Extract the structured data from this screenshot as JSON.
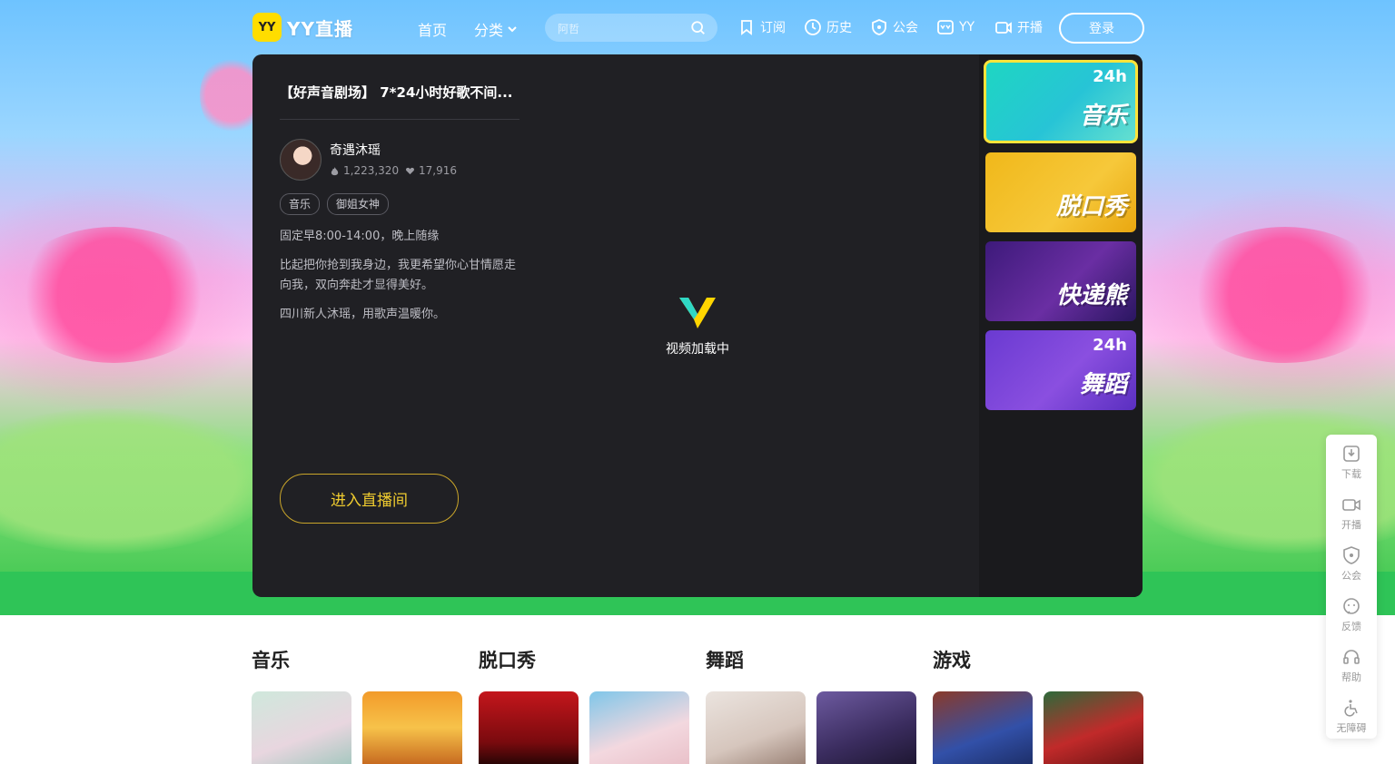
{
  "nav": {
    "logo_mark": "YY",
    "logo_text": "YY直播",
    "home": "首页",
    "category": "分类",
    "search_placeholder": "阿哲",
    "subscribe": "订阅",
    "history": "历史",
    "guild": "公会",
    "yy": "YY",
    "broadcast": "开播",
    "login": "登录"
  },
  "room": {
    "title": "【好声音剧场】 7*24小时好歌不间...",
    "host_name": "奇遇沐瑶",
    "popularity": "1,223,320",
    "likes": "17,916",
    "tags": [
      "音乐",
      "御姐女神"
    ],
    "desc1": "固定早8:00-14:00，晚上随缘",
    "desc2": "比起把你抢到我身边，我更希望你心甘情愿走向我，双向奔赴才显得美好。",
    "desc3": "四川新人沐瑶，用歌声温暖你。",
    "enter_label": "进入直播间",
    "loading_text": "视频加载中"
  },
  "channels": [
    {
      "label": "音乐",
      "badge": "24h",
      "active": true
    },
    {
      "label": "脱口秀",
      "badge": "",
      "active": false
    },
    {
      "label": "快递熊",
      "badge": "",
      "active": false
    },
    {
      "label": "舞蹈",
      "badge": "24h",
      "active": false
    }
  ],
  "float_bar": [
    "下载",
    "开播",
    "公会",
    "反馈",
    "帮助",
    "无障碍"
  ],
  "sections": [
    "音乐",
    "脱口秀",
    "舞蹈",
    "游戏"
  ],
  "colors": {
    "accent_yellow": "#ffdd00",
    "enter_gold": "#f0cc2f",
    "player_bg": "#202024"
  }
}
